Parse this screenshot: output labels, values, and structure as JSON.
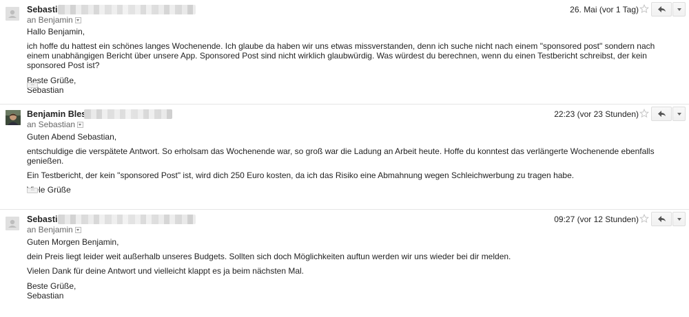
{
  "messages": [
    {
      "sender": "Sebastian",
      "to_label": "an Benjamin",
      "date": "26. Mai (vor 1 Tag)",
      "avatar": "default-avatar",
      "paragraphs": [
        "Hallo Benjamin,",
        "ich hoffe du hattest ein schönes langes Wochenende. Ich glaube da haben wir uns etwas missverstanden, denn ich suche nicht nach einem \"sponsored post\" sondern nach einem unabhängigen Bericht über unsere App. Sponsored Post sind nicht wirklich glaubwürdig. Was würdest du berechnen, wenn du einen Testbericht schreibst, der kein sponsored Post ist?",
        "Beste Grüße,",
        "Sebastian"
      ],
      "dots": "···"
    },
    {
      "sender": "Benjamin Blessing",
      "to_label": "an Sebastian",
      "date": "22:23 (vor 23 Stunden)",
      "avatar": "photo-avatar",
      "paragraphs": [
        "Guten Abend Sebastian,",
        "entschuldige die verspätete Antwort. So erholsam das Wochenende war, so groß war die Ladung an Arbeit heute. Hoffe du konntest das verlängerte Wochenende ebenfalls genießen.",
        "Ein Testbericht, der kein \"sponsored Post\" ist, wird dich 250 Euro kosten, da ich das Risiko eine Abmahnung wegen Schleichwerbung zu tragen habe.",
        "Viele Grüße"
      ],
      "dots": "···"
    },
    {
      "sender": "Sebastian",
      "to_label": "an Benjamin",
      "date": "09:27 (vor 12 Stunden)",
      "avatar": "default-avatar",
      "paragraphs": [
        "Guten Morgen Benjamin,",
        "dein Preis liegt leider weit außerhalb unseres Budgets. Sollten sich doch Möglichkeiten auftun werden wir uns wieder bei dir melden.",
        "Vielen Dank für deine Antwort und vielleicht klappt es ja beim nächsten Mal.",
        "Beste Grüße,",
        "Sebastian"
      ]
    }
  ],
  "icons": {
    "star": "star-outline-icon",
    "reply": "reply-icon",
    "more": "chevron-down-icon"
  }
}
